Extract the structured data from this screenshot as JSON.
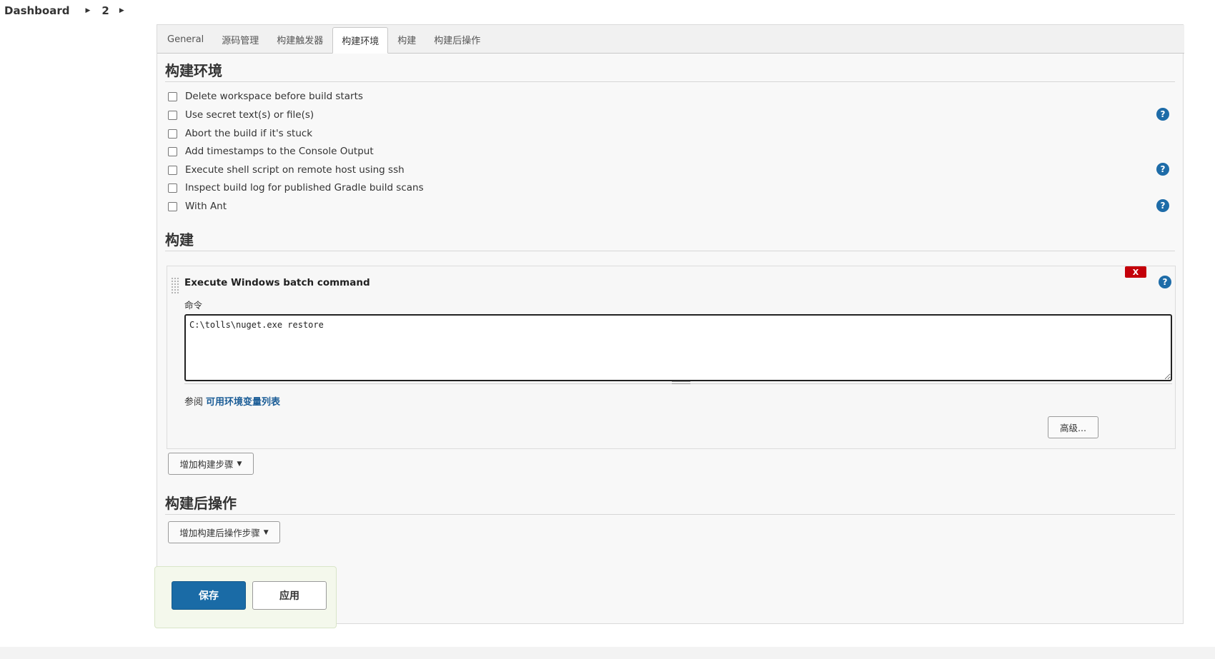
{
  "breadcrumb": {
    "items": [
      "Dashboard",
      "2"
    ],
    "separator": "▶"
  },
  "tabs": [
    "General",
    "源码管理",
    "构建触发器",
    "构建环境",
    "构建",
    "构建后操作"
  ],
  "active_tab": "构建环境",
  "build_env": {
    "title": "构建环境",
    "options": [
      {
        "label": "Delete workspace before build starts",
        "checked": false,
        "help": false
      },
      {
        "label": "Use secret text(s) or file(s)",
        "checked": false,
        "help": true
      },
      {
        "label": "Abort the build if it's stuck",
        "checked": false,
        "help": false
      },
      {
        "label": "Add timestamps to the Console Output",
        "checked": false,
        "help": false
      },
      {
        "label": "Execute shell script on remote host using ssh",
        "checked": false,
        "help": true
      },
      {
        "label": "Inspect build log for published Gradle build scans",
        "checked": false,
        "help": false
      },
      {
        "label": "With Ant",
        "checked": false,
        "help": true
      }
    ]
  },
  "build": {
    "title": "构建",
    "step": {
      "title": "Execute Windows batch command",
      "delete_label": "X",
      "field_label": "命令",
      "command": "C:\\tolls\\nuget.exe restore",
      "see_also_prefix": "参阅",
      "see_also_link": "可用环境变量列表",
      "advanced_label": "高级..."
    },
    "add_step_label": "增加构建步骤"
  },
  "post_build": {
    "title": "构建后操作",
    "add_label": "增加构建后操作步骤"
  },
  "footer": {
    "save_label": "保存",
    "apply_label": "应用"
  },
  "help_glyph": "?",
  "colors": {
    "accent": "#1a6ba6",
    "help": "#1e6ca8",
    "danger": "#c4000a",
    "link": "#1a5c96"
  }
}
